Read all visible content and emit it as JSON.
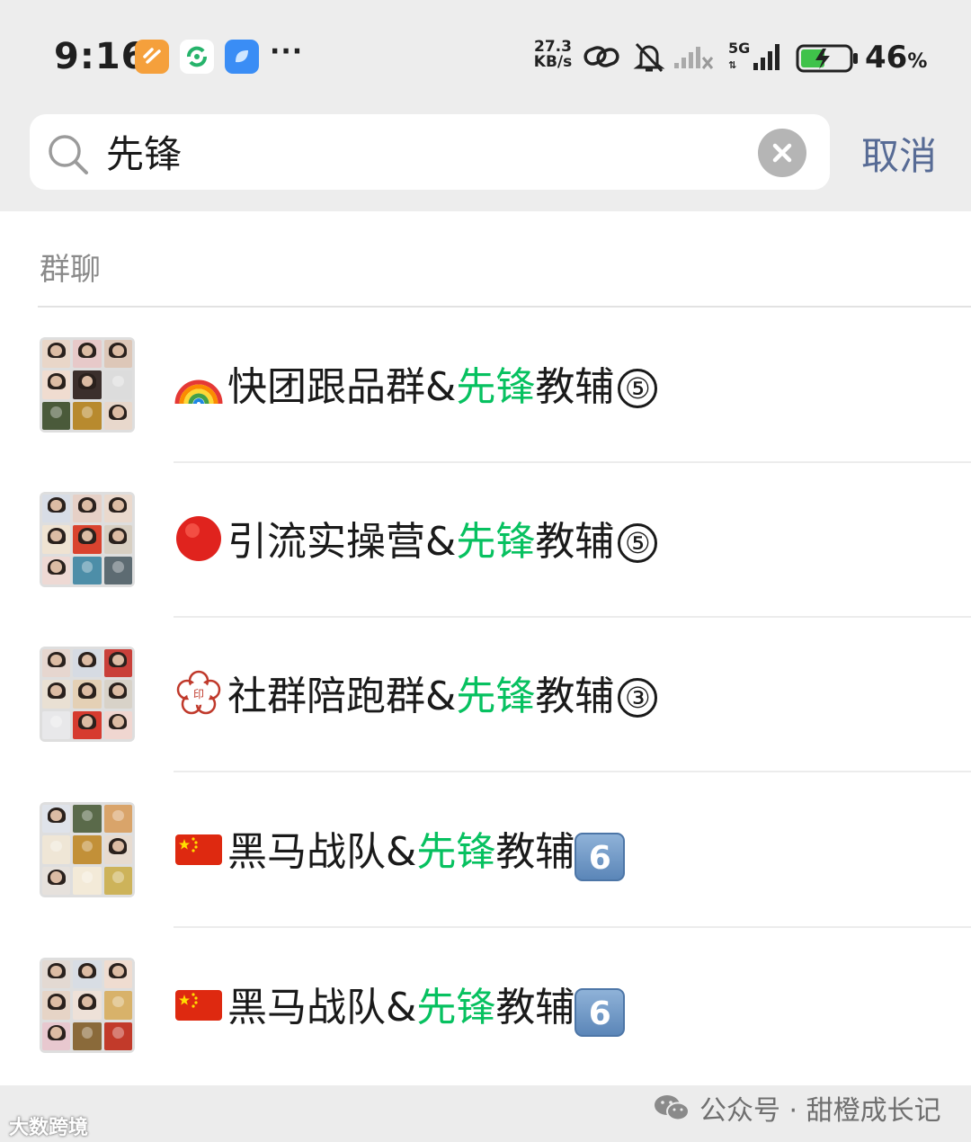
{
  "status_bar": {
    "time": "9:16",
    "more": "···",
    "net_speed_value": "27.3",
    "net_speed_unit": "KB/s",
    "network": "5G",
    "battery_percent": "46",
    "battery_unit": "%",
    "icons": [
      "app-icon-orange",
      "app-icon-green-refresh",
      "app-icon-blue",
      "link-icon",
      "mute-bell-icon",
      "signal-no-service-icon",
      "signal-5g-icon",
      "battery-charging-icon"
    ]
  },
  "search": {
    "value": "先锋",
    "cancel_label": "取消"
  },
  "section": {
    "title": "群聊"
  },
  "colors": {
    "highlight": "#07c160",
    "cancel": "#576b95"
  },
  "results": [
    {
      "emoji": "rainbow",
      "before": "快团跟品群&",
      "match": "先锋",
      "after": "教辅",
      "suffix": "⑤"
    },
    {
      "emoji": "red-circle",
      "before": "引流实操营&",
      "match": "先锋",
      "after": "教辅",
      "suffix": "⑤"
    },
    {
      "emoji": "seal-flower",
      "before": "社群陪跑群&",
      "match": "先锋",
      "after": "教辅",
      "suffix": "③"
    },
    {
      "emoji": "china-flag",
      "before": "黑马战队&",
      "match": "先锋",
      "after": "教辅",
      "suffix": "6"
    },
    {
      "emoji": "china-flag",
      "before": "黑马战队&",
      "match": "先锋",
      "after": "教辅",
      "suffix": "6"
    }
  ],
  "watermark": {
    "left": "大数跨境",
    "right": "公众号 · 甜橙成长记"
  }
}
